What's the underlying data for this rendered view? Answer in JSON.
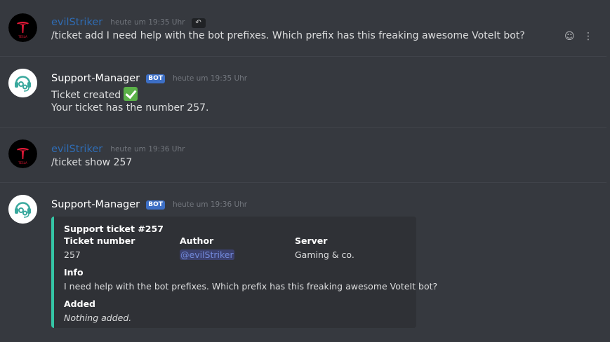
{
  "messages": [
    {
      "author": "evilStriker",
      "timestamp": "heute um 19:35 Uhr",
      "edit_badge": "↶",
      "content": "/ticket add I need help with the bot prefixes. Which prefix has this freaking awesome VoteIt bot?",
      "avatar_text": "TESLA"
    },
    {
      "author": "Support-Manager",
      "bot_tag": "BOT",
      "timestamp": "heute um 19:35 Uhr",
      "line1": "Ticket created",
      "line2": "Your ticket has the number 257."
    },
    {
      "author": "evilStriker",
      "timestamp": "heute um 19:36 Uhr",
      "content": "/ticket show 257",
      "avatar_text": "TESLA"
    },
    {
      "author": "Support-Manager",
      "bot_tag": "BOT",
      "timestamp": "heute um 19:36 Uhr"
    }
  ],
  "embed": {
    "title": "Support ticket #257",
    "fields": [
      {
        "name": "Ticket number",
        "value": "257"
      },
      {
        "name": "Author",
        "value": "@evilStriker"
      },
      {
        "name": "Server",
        "value": "Gaming & co."
      },
      {
        "name": "Info",
        "value": "I need help with the bot prefixes. Which prefix has this freaking awesome VoteIt bot?"
      },
      {
        "name": "Added",
        "value": "Nothing added."
      }
    ],
    "accent_color": "#35c5a5"
  },
  "icons": [
    "emoji-react-icon",
    "more-options-icon"
  ]
}
